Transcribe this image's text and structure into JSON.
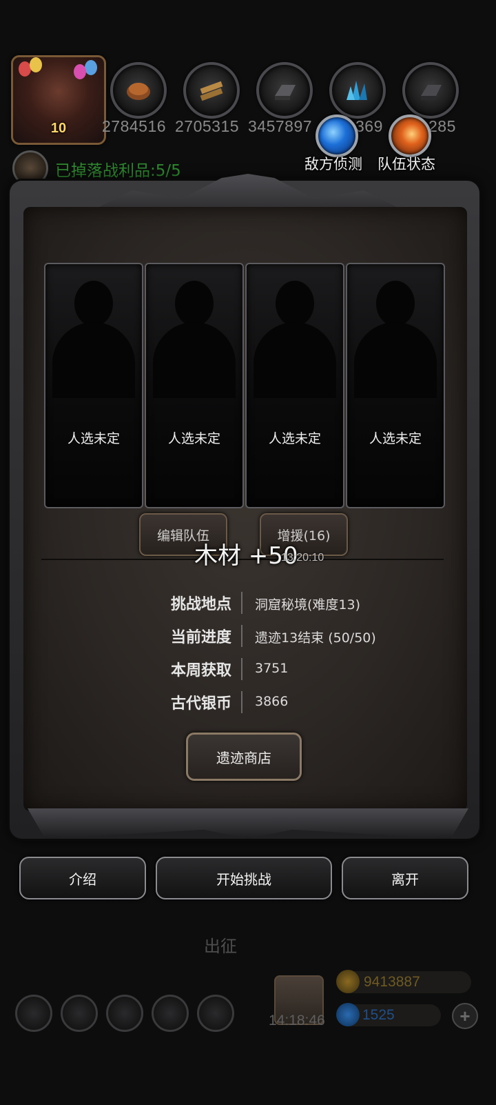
{
  "player": {
    "level": "10"
  },
  "resources": [
    {
      "icon": "bread-icon",
      "value": "2784516"
    },
    {
      "icon": "wood-plank-icon",
      "value": "2705315"
    },
    {
      "icon": "iron-ingot-icon",
      "value": "3457897"
    },
    {
      "icon": "crystal-icon",
      "value": "369"
    },
    {
      "icon": "silver-bar-icon",
      "value": "285"
    }
  ],
  "actions_top": {
    "scout_label": "敌方侦测",
    "team_status_label": "队伍状态"
  },
  "loot_status": "已掉落战利品:5/5",
  "team_slots": [
    {
      "label": "人选未定"
    },
    {
      "label": "人选未定"
    },
    {
      "label": "人选未定"
    },
    {
      "label": "人选未定"
    }
  ],
  "team_buttons": {
    "edit_label": "编辑队伍",
    "reinforce_label": "增援(16)"
  },
  "floating_notice": {
    "text": "木材 +50",
    "time": "13:20:10"
  },
  "info": {
    "location_label": "挑战地点",
    "location_value": "洞窟秘境(难度13)",
    "progress_label": "当前进度",
    "progress_value": "遗迹13结束 (50/50)",
    "weekly_label": "本周获取",
    "weekly_value": "3751",
    "coins_label": "古代银币",
    "coins_value": "3866"
  },
  "shop_button": "遗迹商店",
  "bottom_actions": {
    "intro": "介绍",
    "start": "开始挑战",
    "leave": "离开"
  },
  "background": {
    "sortie_label": "出征",
    "clock": "14:18:46",
    "gold_value": "9413887",
    "gem_value": "1525",
    "plus": "+"
  },
  "colors": {
    "loot_text": "#2f8a30",
    "gold_text": "#6e5a22",
    "gem_text": "#1f4f8a"
  }
}
